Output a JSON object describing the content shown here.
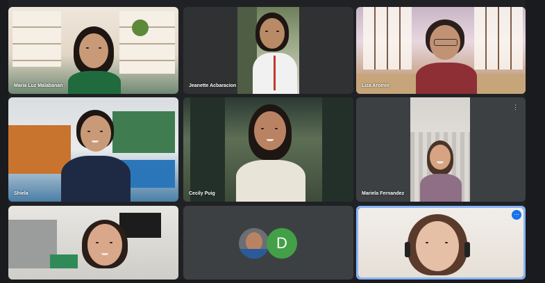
{
  "meeting": {
    "participants": [
      {
        "name": "Maria Luz Malabanan"
      },
      {
        "name": "Jeanette Acbaracion"
      },
      {
        "name": "Liza Aromin"
      },
      {
        "name": "Shiela"
      },
      {
        "name": "Cecily Puig"
      },
      {
        "name": "Mariela Fernandez"
      },
      {
        "name": ""
      },
      {
        "name": "",
        "avatar_letter": "D",
        "avatar_color": "#43a047"
      },
      {
        "name": ""
      }
    ],
    "active_speaker_color": "#8ab4f8",
    "icons": {
      "more_options": "more-options-icon",
      "pin": "pin-icon"
    }
  }
}
